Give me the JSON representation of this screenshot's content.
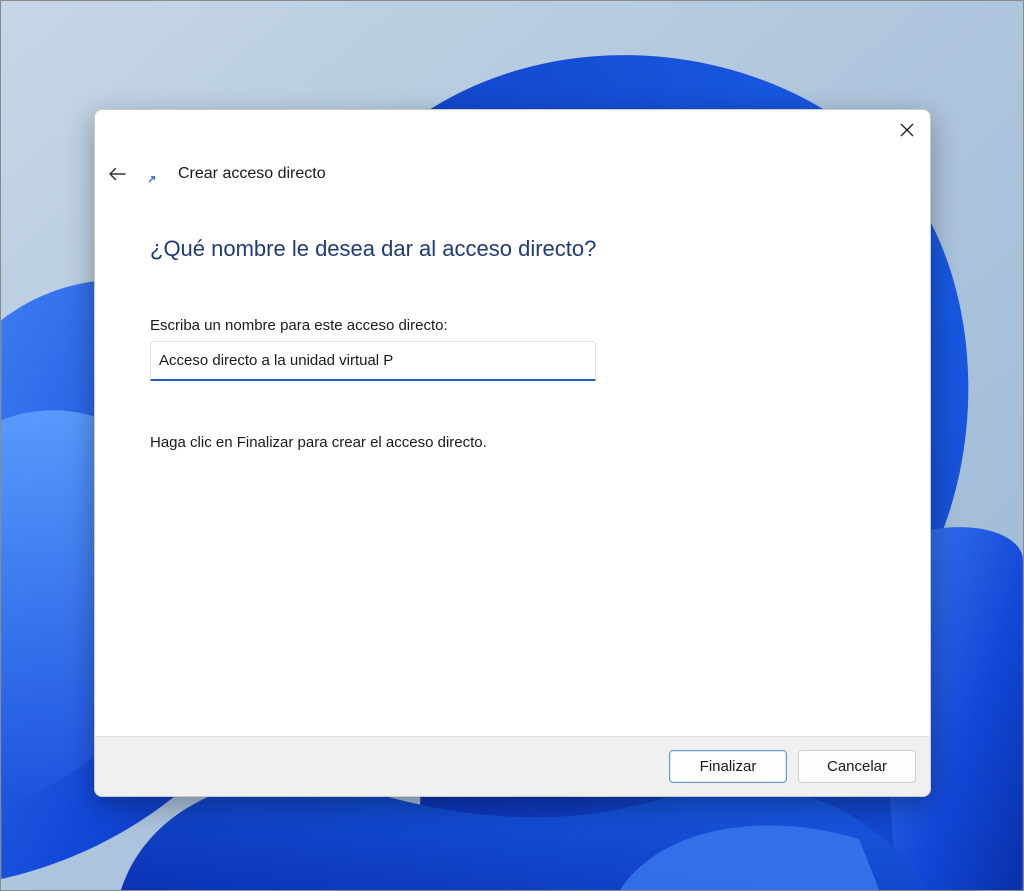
{
  "dialog": {
    "wizard_title": "Crear acceso directo",
    "heading": "¿Qué nombre le desea dar al acceso directo?",
    "field_label": "Escriba un nombre para este acceso directo:",
    "name_value": "Acceso directo a la unidad virtual P",
    "hint": "Haga clic en Finalizar para crear el acceso directo.",
    "buttons": {
      "finish": "Finalizar",
      "cancel": "Cancelar"
    }
  },
  "icons": {
    "close": "close-icon",
    "back": "back-arrow-icon",
    "wizard": "shortcut-icon"
  },
  "colors": {
    "heading": "#1e3a78",
    "accent": "#1f5fb8",
    "footer": "#f0f0f0"
  }
}
